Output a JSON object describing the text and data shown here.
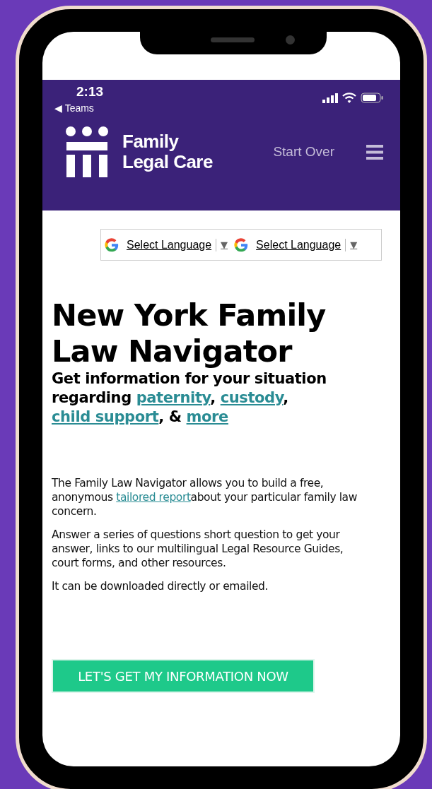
{
  "status_bar": {
    "time": "2:13",
    "back_label": "◀ Teams"
  },
  "header": {
    "logo_lines": [
      "Family",
      "Legal Care"
    ],
    "start_over": "Start Over"
  },
  "language_widgets": [
    {
      "label": "Select Language",
      "arrow": "▼"
    },
    {
      "label": "Select Language",
      "arrow": "▼"
    }
  ],
  "title": "New York Family Law Navigator",
  "subtitle": [
    {
      "kind": "text",
      "text": "Get information for your situation regarding "
    },
    {
      "kind": "link",
      "text": "paternity"
    },
    {
      "kind": "text",
      "text": ", "
    },
    {
      "kind": "link",
      "text": "custody"
    },
    {
      "kind": "text",
      "text": ", "
    },
    {
      "kind": "link",
      "text": "child support"
    },
    {
      "kind": "text",
      "text": ", & "
    },
    {
      "kind": "link",
      "text": "more"
    }
  ],
  "paragraphs": [
    [
      {
        "kind": "text",
        "text": "The Family Law Navigator allows you to build a free, anonymous "
      },
      {
        "kind": "link",
        "text": "tailored report"
      },
      {
        "kind": "text",
        "text": "about your particular family law concern."
      }
    ],
    [
      {
        "kind": "text",
        "text": "Answer a series of questions short question to get your answer, links to our multilingual Legal Resource Guides, court forms, and other resources."
      }
    ],
    [
      {
        "kind": "text",
        "text": "It can be downloaded directly or emailed."
      }
    ]
  ],
  "cta_button": "LET'S GET MY INFORMATION NOW"
}
